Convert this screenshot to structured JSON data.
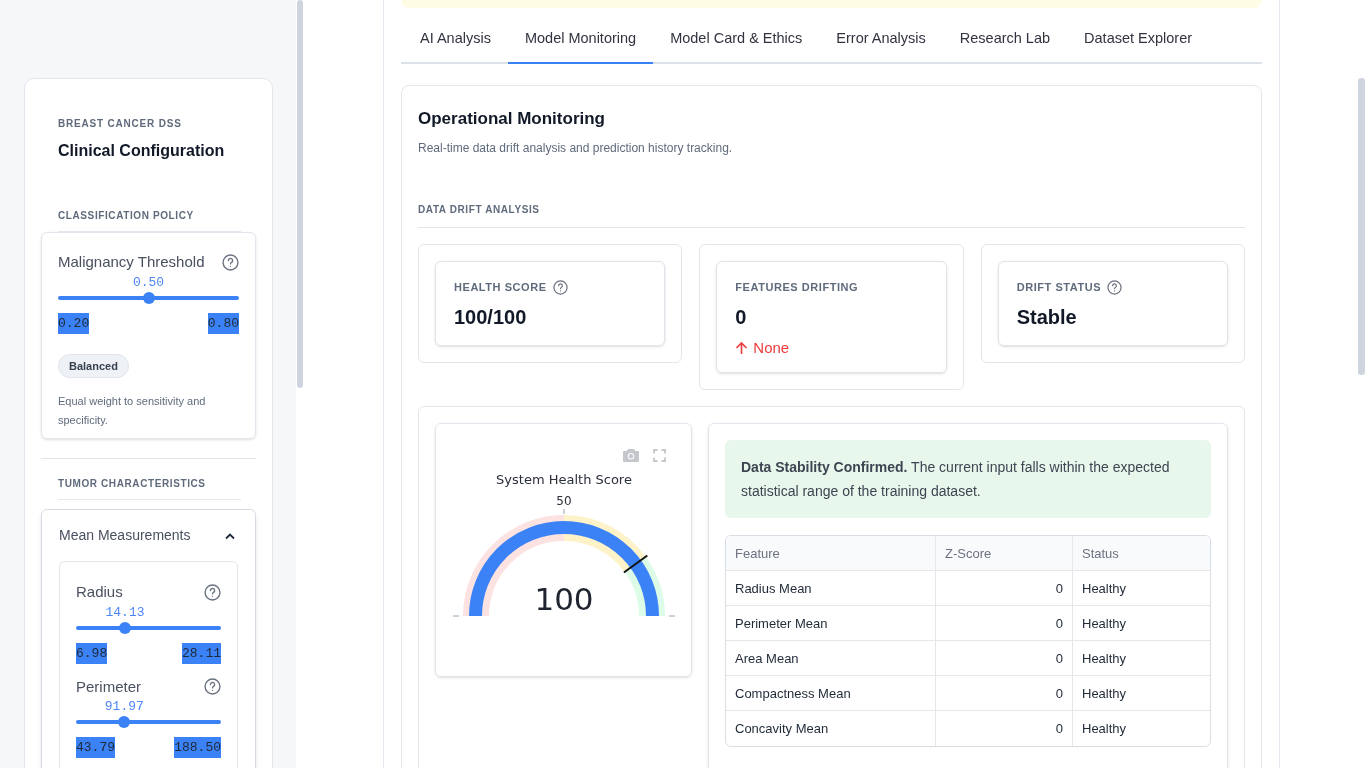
{
  "sidebar": {
    "eyebrow": "BREAST CANCER DSS",
    "title": "Clinical Configuration",
    "policy": {
      "heading": "CLASSIFICATION POLICY",
      "slider": {
        "label": "Malignancy Threshold",
        "value": "0.50",
        "min": "0.20",
        "max": "0.80",
        "level": 0.5
      },
      "badge": "Balanced",
      "description": "Equal weight to sensitivity and specificity."
    },
    "tumor": {
      "heading": "TUMOR CHARACTERISTICS",
      "expander": {
        "title": "Mean Measurements",
        "expanded": true,
        "sliders": [
          {
            "label": "Radius",
            "value": "14.13",
            "min": "6.98",
            "max": "28.11",
            "level": 0.338
          },
          {
            "label": "Perimeter",
            "value": "91.97",
            "min": "43.79",
            "max": "188.50",
            "level": 0.333
          }
        ]
      }
    }
  },
  "tabs": [
    {
      "label": "AI Analysis",
      "selected": false
    },
    {
      "label": "Model Monitoring",
      "selected": true
    },
    {
      "label": "Model Card & Ethics",
      "selected": false
    },
    {
      "label": "Error Analysis",
      "selected": false
    },
    {
      "label": "Research Lab",
      "selected": false
    },
    {
      "label": "Dataset Explorer",
      "selected": false
    }
  ],
  "panel": {
    "title": "Operational Monitoring",
    "subtitle": "Real-time data drift analysis and prediction history tracking.",
    "section_heading": "DATA DRIFT ANALYSIS",
    "metrics": [
      {
        "label": "HEALTH SCORE",
        "help": true,
        "value": "100/100"
      },
      {
        "label": "FEATURES DRIFTING",
        "help": false,
        "value": "0",
        "delta": {
          "text": "None"
        }
      },
      {
        "label": "DRIFT STATUS",
        "help": true,
        "value": "Stable"
      }
    ],
    "gauge": {
      "title": "System Health Score",
      "tick_label": "50",
      "value": "100",
      "level": 1
    },
    "alert": "**Data Stability Confirmed.** The current input falls within the expected statistical range of the training dataset.",
    "table": {
      "columns": [
        "Feature",
        "Z-Score",
        "Status"
      ],
      "rows": [
        [
          "Radius Mean",
          "0",
          "Healthy"
        ],
        [
          "Perimeter Mean",
          "0",
          "Healthy"
        ],
        [
          "Area Mean",
          "0",
          "Healthy"
        ],
        [
          "Compactness Mean",
          "0",
          "Healthy"
        ],
        [
          "Concavity Mean",
          "0",
          "Healthy"
        ]
      ]
    }
  }
}
